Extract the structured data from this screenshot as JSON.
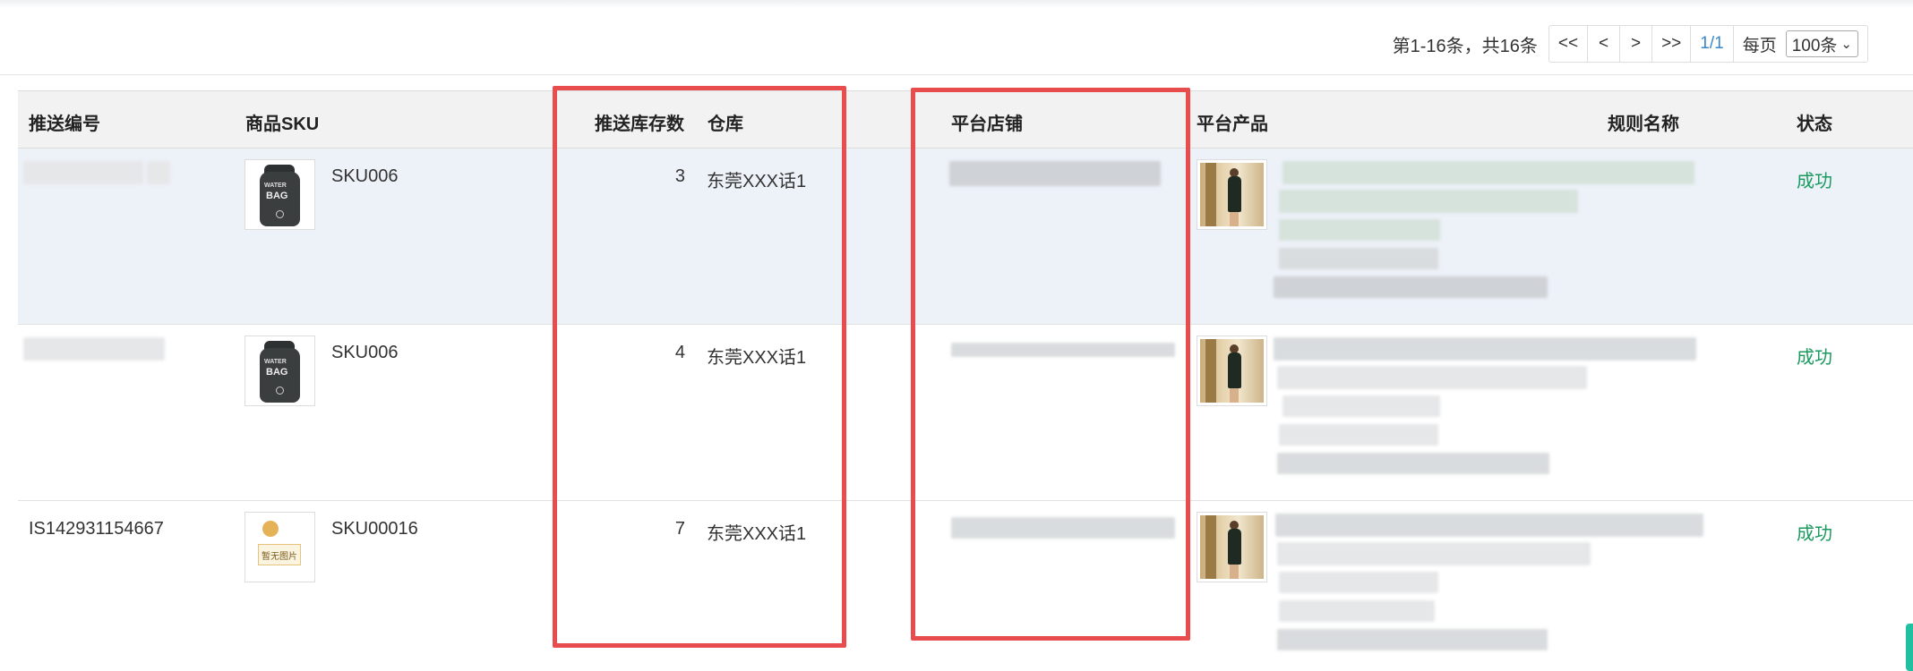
{
  "pagination": {
    "summary": "第1-16条，共16条",
    "first": "<<",
    "prev": "<",
    "next": ">",
    "last": ">>",
    "page": "1/1",
    "per_page_label": "每页",
    "per_page_value": "100条"
  },
  "columns": {
    "push_no": "推送编号",
    "sku": "商品SKU",
    "push_qty": "推送库存数",
    "warehouse": "仓库",
    "store": "平台店铺",
    "product": "平台产品",
    "rule": "规则名称",
    "status": "状态"
  },
  "rows": [
    {
      "push_no": "",
      "sku": "SKU006",
      "image": "water-bag",
      "qty": "3",
      "warehouse": "东莞XXX话1",
      "status": "成功"
    },
    {
      "push_no": "",
      "sku": "SKU006",
      "image": "water-bag",
      "qty": "4",
      "warehouse": "东莞XXX话1",
      "status": "成功"
    },
    {
      "push_no": "IS142931154667",
      "sku": "SKU00016",
      "image": "no-image",
      "qty": "7",
      "warehouse": "东莞XXX话1",
      "status": "成功"
    }
  ],
  "product_image": {
    "name": "product-photo"
  },
  "no_image_label": "暂无图片",
  "bag_label_top": "WATER",
  "bag_label_main": "BAG",
  "colors": {
    "highlight_box": "#e84c4c",
    "status_success": "#1a9a5f",
    "page_link": "#3a87c8",
    "row_highlight": "#edf1f8"
  }
}
